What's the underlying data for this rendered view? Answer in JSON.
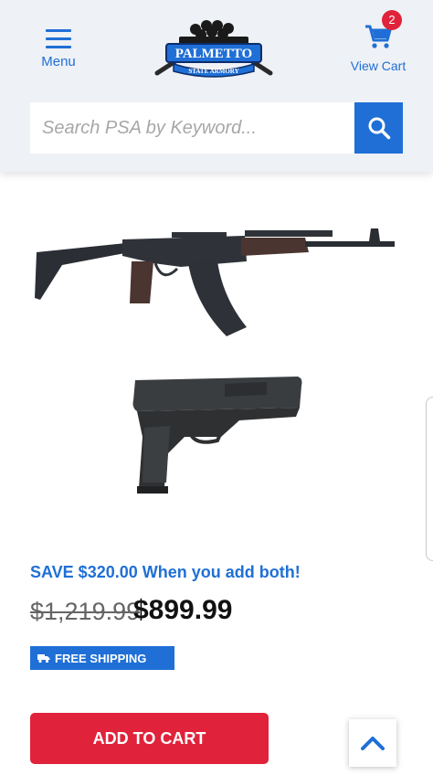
{
  "header": {
    "menu_label": "Menu",
    "cart_label": "View Cart",
    "cart_count": "2",
    "logo_name": "PALMETTO",
    "logo_sub": "STATE ARMORY"
  },
  "search": {
    "placeholder": "Search PSA by Keyword..."
  },
  "bundle": {
    "save_text": "SAVE $320.00 When you add both!",
    "old_price": "$1,219.99",
    "new_price": "$899.99",
    "shipping_label": "FREE SHIPPING",
    "add_to_cart": "ADD TO CART"
  },
  "icons": {
    "menu": "hamburger-icon",
    "cart": "cart-icon",
    "search": "search-icon",
    "shipping": "truck-icon",
    "to_top": "chevron-up-icon"
  },
  "colors": {
    "accent_blue": "#1f6fd6",
    "cta_red": "#e0223a",
    "header_bg": "#eef1f5"
  }
}
